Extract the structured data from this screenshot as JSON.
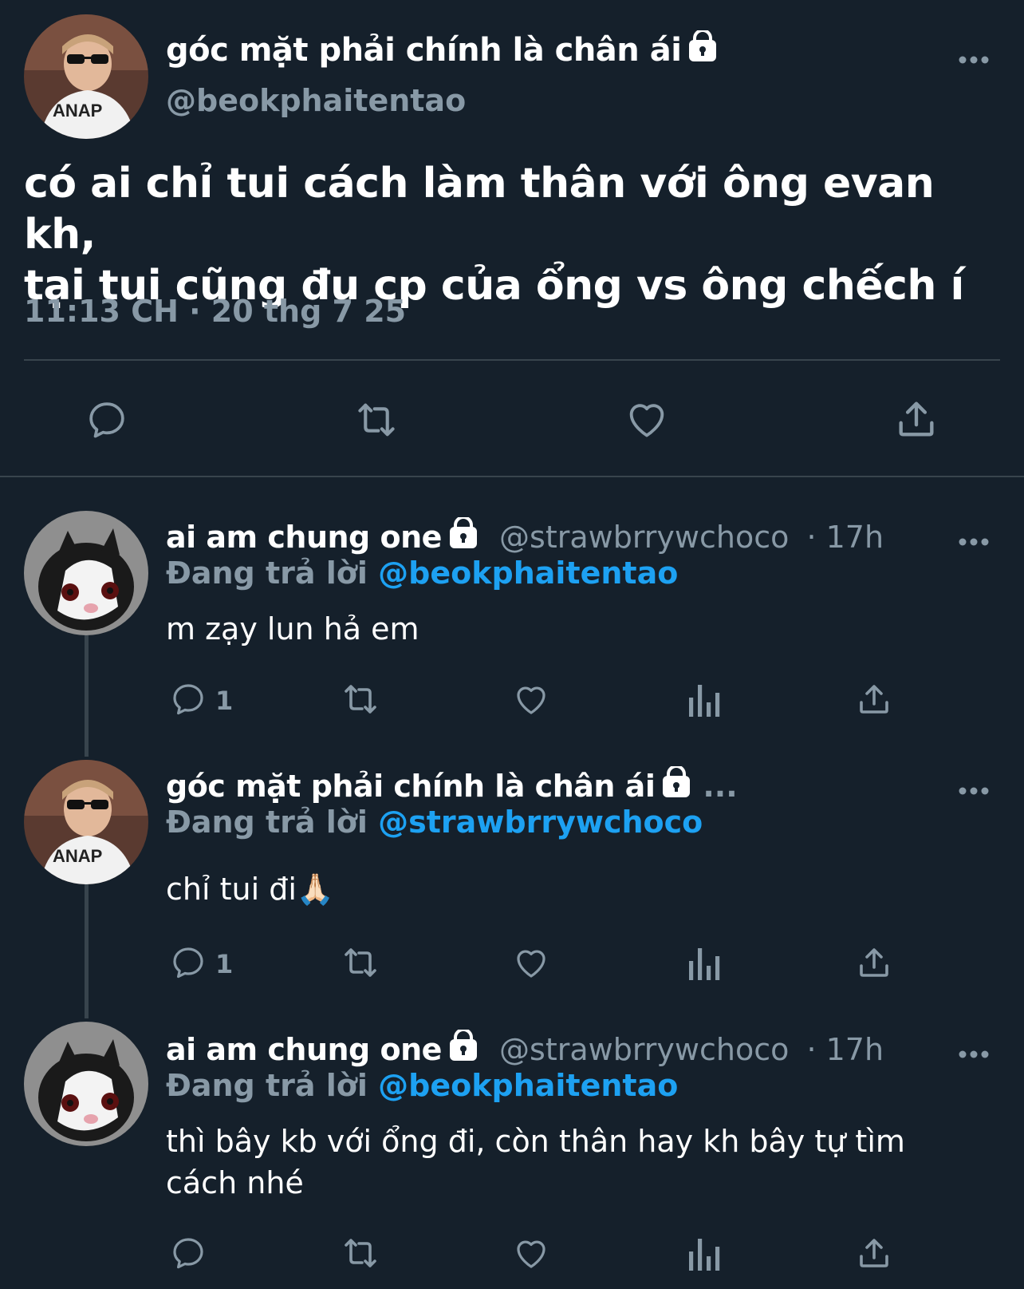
{
  "main_tweet": {
    "display_name": "góc mặt phải chính là chân ái",
    "handle": "@beokphaitentao",
    "text_line1": "có ai chỉ tui cách làm thân với ông evan kh,",
    "text_line2": "tại tui cũng đu cp của ổng vs ông chếch í",
    "timestamp": "11:13 CH · 20 thg 7 25"
  },
  "replies": [
    {
      "display_name": "ai am chung one",
      "handle": "@strawbrrywchoco",
      "time": "· 17h",
      "replying_label": "Đang trả lời",
      "replying_to": "@beokphaitentao",
      "text": "m zạy lun hả em",
      "reply_count": "1"
    },
    {
      "display_name": "góc mặt phải chính là chân ái",
      "truncation": "...",
      "replying_label": "Đang trả lời",
      "replying_to": "@strawbrrywchoco",
      "text": "chỉ tui đi🙏🏻",
      "reply_count": "1"
    },
    {
      "display_name": "ai am chung one",
      "handle": "@strawbrrywchoco",
      "time": "· 17h",
      "replying_label": "Đang trả lời",
      "replying_to": "@beokphaitentao",
      "text_line1": "thì bây kb với ổng đi, còn thân hay kh bây tự tìm",
      "text_line2": "cách nhé",
      "reply_count": ""
    }
  ],
  "colors": {
    "background": "#15202b",
    "secondary_text": "#8899a6",
    "mention": "#1da1f2",
    "divider": "#38444d"
  },
  "icons": [
    "more-icon",
    "lock-icon",
    "reply-icon",
    "retweet-icon",
    "like-icon",
    "analytics-icon",
    "share-icon"
  ]
}
